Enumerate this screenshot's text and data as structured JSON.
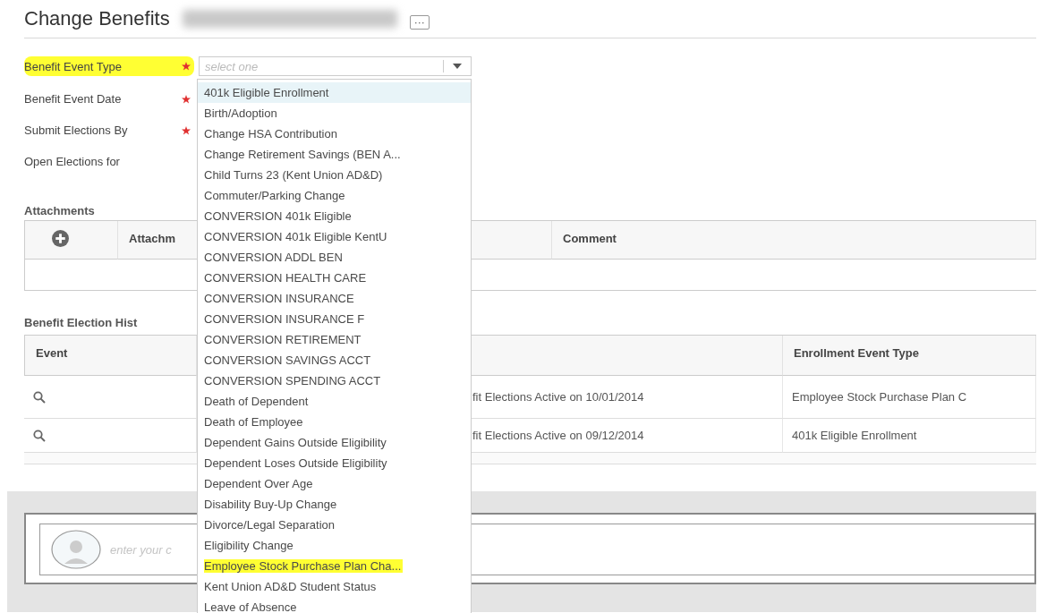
{
  "page": {
    "title": "Change Benefits",
    "more_button": "···"
  },
  "form": {
    "fields": [
      {
        "label": "Benefit Event Type",
        "required": true,
        "highlighted": true,
        "placeholder": "select one"
      },
      {
        "label": "Benefit Event Date",
        "required": true,
        "highlighted": false
      },
      {
        "label": "Submit Elections By",
        "required": true,
        "highlighted": false
      },
      {
        "label": "Open Elections for",
        "required": false,
        "highlighted": false
      }
    ]
  },
  "dropdown": {
    "items": [
      {
        "label": "401k Eligible Enrollment",
        "selected": true,
        "highlighted": false
      },
      {
        "label": "Birth/Adoption",
        "selected": false,
        "highlighted": false
      },
      {
        "label": "Change HSA Contribution",
        "selected": false,
        "highlighted": false
      },
      {
        "label": "Change Retirement Savings (BEN A...",
        "selected": false,
        "highlighted": false
      },
      {
        "label": "Child Turns 23 (Kent Union AD&D)",
        "selected": false,
        "highlighted": false
      },
      {
        "label": "Commuter/Parking Change",
        "selected": false,
        "highlighted": false
      },
      {
        "label": "CONVERSION 401k Eligible",
        "selected": false,
        "highlighted": false
      },
      {
        "label": "CONVERSION 401k Eligible KentU",
        "selected": false,
        "highlighted": false
      },
      {
        "label": "CONVERSION ADDL BEN",
        "selected": false,
        "highlighted": false
      },
      {
        "label": "CONVERSION HEALTH CARE",
        "selected": false,
        "highlighted": false
      },
      {
        "label": "CONVERSION INSURANCE",
        "selected": false,
        "highlighted": false
      },
      {
        "label": "CONVERSION INSURANCE F",
        "selected": false,
        "highlighted": false
      },
      {
        "label": "CONVERSION RETIREMENT",
        "selected": false,
        "highlighted": false
      },
      {
        "label": "CONVERSION SAVINGS ACCT",
        "selected": false,
        "highlighted": false
      },
      {
        "label": "CONVERSION SPENDING ACCT",
        "selected": false,
        "highlighted": false
      },
      {
        "label": "Death of Dependent",
        "selected": false,
        "highlighted": false
      },
      {
        "label": "Death of Employee",
        "selected": false,
        "highlighted": false
      },
      {
        "label": "Dependent Gains Outside Eligibility",
        "selected": false,
        "highlighted": false
      },
      {
        "label": "Dependent Loses Outside Eligibility",
        "selected": false,
        "highlighted": false
      },
      {
        "label": "Dependent Over Age",
        "selected": false,
        "highlighted": false
      },
      {
        "label": "Disability Buy-Up Change",
        "selected": false,
        "highlighted": false
      },
      {
        "label": "Divorce/Legal Separation",
        "selected": false,
        "highlighted": false
      },
      {
        "label": "Eligibility Change",
        "selected": false,
        "highlighted": false
      },
      {
        "label": "Employee Stock Purchase Plan Cha...",
        "selected": false,
        "highlighted": true
      },
      {
        "label": "Kent Union AD&D Student Status",
        "selected": false,
        "highlighted": false
      },
      {
        "label": "Leave of Absence",
        "selected": false,
        "highlighted": false
      }
    ]
  },
  "attachments": {
    "title": "Attachments",
    "columns": [
      "Attachm",
      "Comment"
    ]
  },
  "history": {
    "title": "Benefit Election Hist",
    "columns": [
      "Event",
      "Enrollment Event Type"
    ],
    "rows": [
      {
        "column_3": "fit Elections Active on 10/01/2014",
        "column_4": "Employee Stock Purchase Plan C"
      },
      {
        "column_3": "fit Elections Active on 09/12/2014",
        "column_4": "401k Eligible Enrollment"
      }
    ]
  },
  "comment": {
    "placeholder": "enter your c"
  }
}
